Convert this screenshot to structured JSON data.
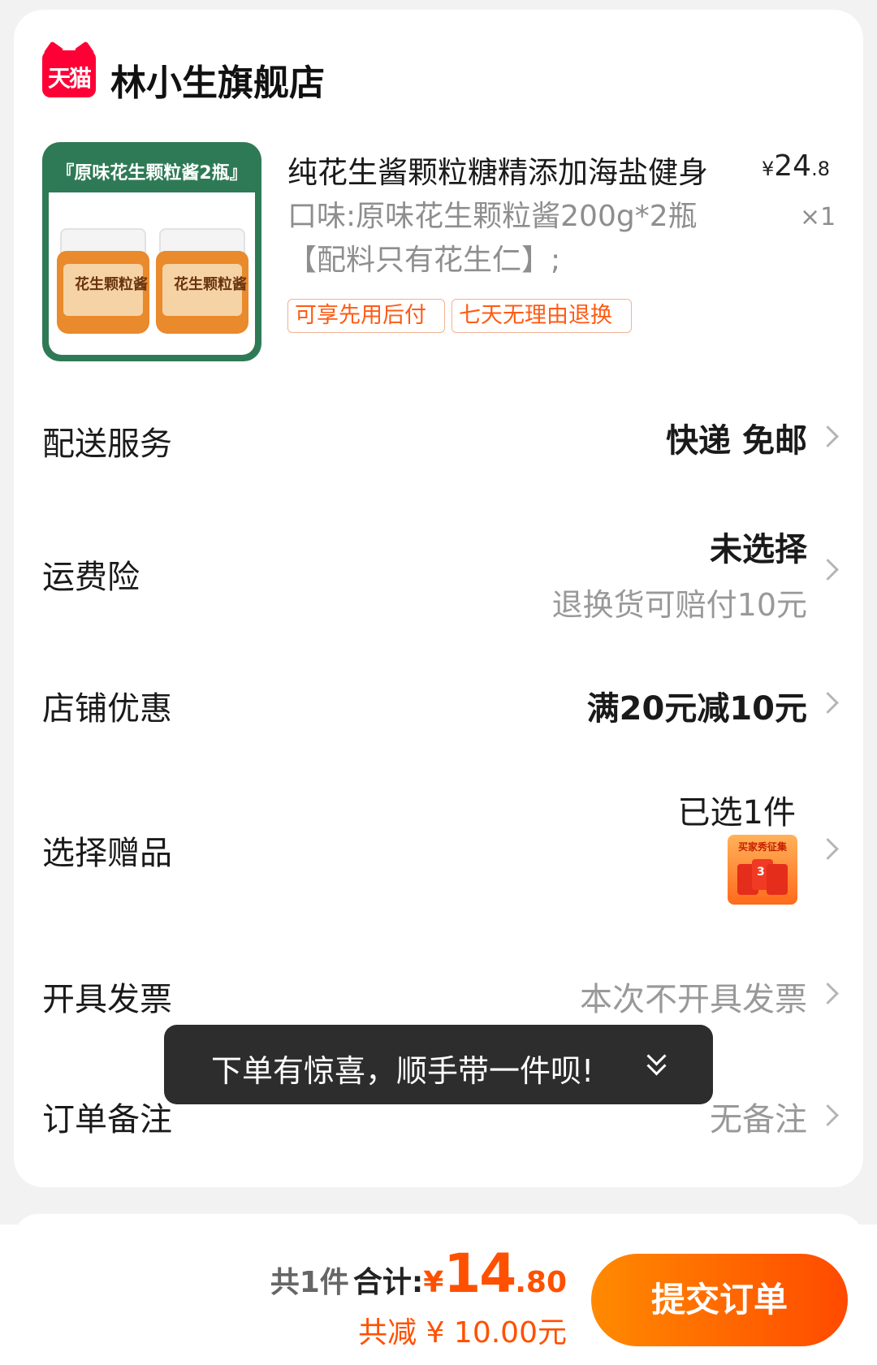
{
  "store": {
    "badge": "天猫",
    "name": "林小生旗舰店"
  },
  "product": {
    "image_banner": "『原味花生颗粒酱2瓶』",
    "jar_label": "花生颗粒酱",
    "title": "纯花生酱颗粒糖精添加海盐健身",
    "price_symbol": "¥",
    "price_int": "24",
    "price_dec": ".8",
    "quantity": "×1",
    "spec": "口味:原味花生颗粒酱200g*2瓶【配料只有花生仁】;",
    "tags": [
      "可享先用后付",
      "七天无理由退换"
    ]
  },
  "rows": {
    "delivery": {
      "label": "配送服务",
      "value": "快递 免邮"
    },
    "insurance": {
      "label": "运费险",
      "value": "未选择",
      "sub": "退换货可赔付10元"
    },
    "store_discount": {
      "label": "店铺优惠",
      "value": "满20元减10元"
    },
    "gift": {
      "label": "选择赠品",
      "value": "已选1件",
      "thumb_text": "买家秀征集",
      "thumb_num": "3"
    },
    "invoice": {
      "label": "开具发票",
      "value": "本次不开具发票"
    },
    "note": {
      "label": "订单备注",
      "value": "无备注"
    }
  },
  "toast": {
    "text": "下单有惊喜，顺手带一件呗!"
  },
  "bottom": {
    "count": "共1件",
    "total_label": "合计:",
    "total_symbol": "¥",
    "total_int": "14",
    "total_dec": ".80",
    "discount": "共减 ¥ 10.00元",
    "submit_label": "提交订单"
  },
  "colors": {
    "accent": "#ff5000",
    "tmall_red": "#ff0036",
    "toast_bg": "#2d2d2d"
  }
}
